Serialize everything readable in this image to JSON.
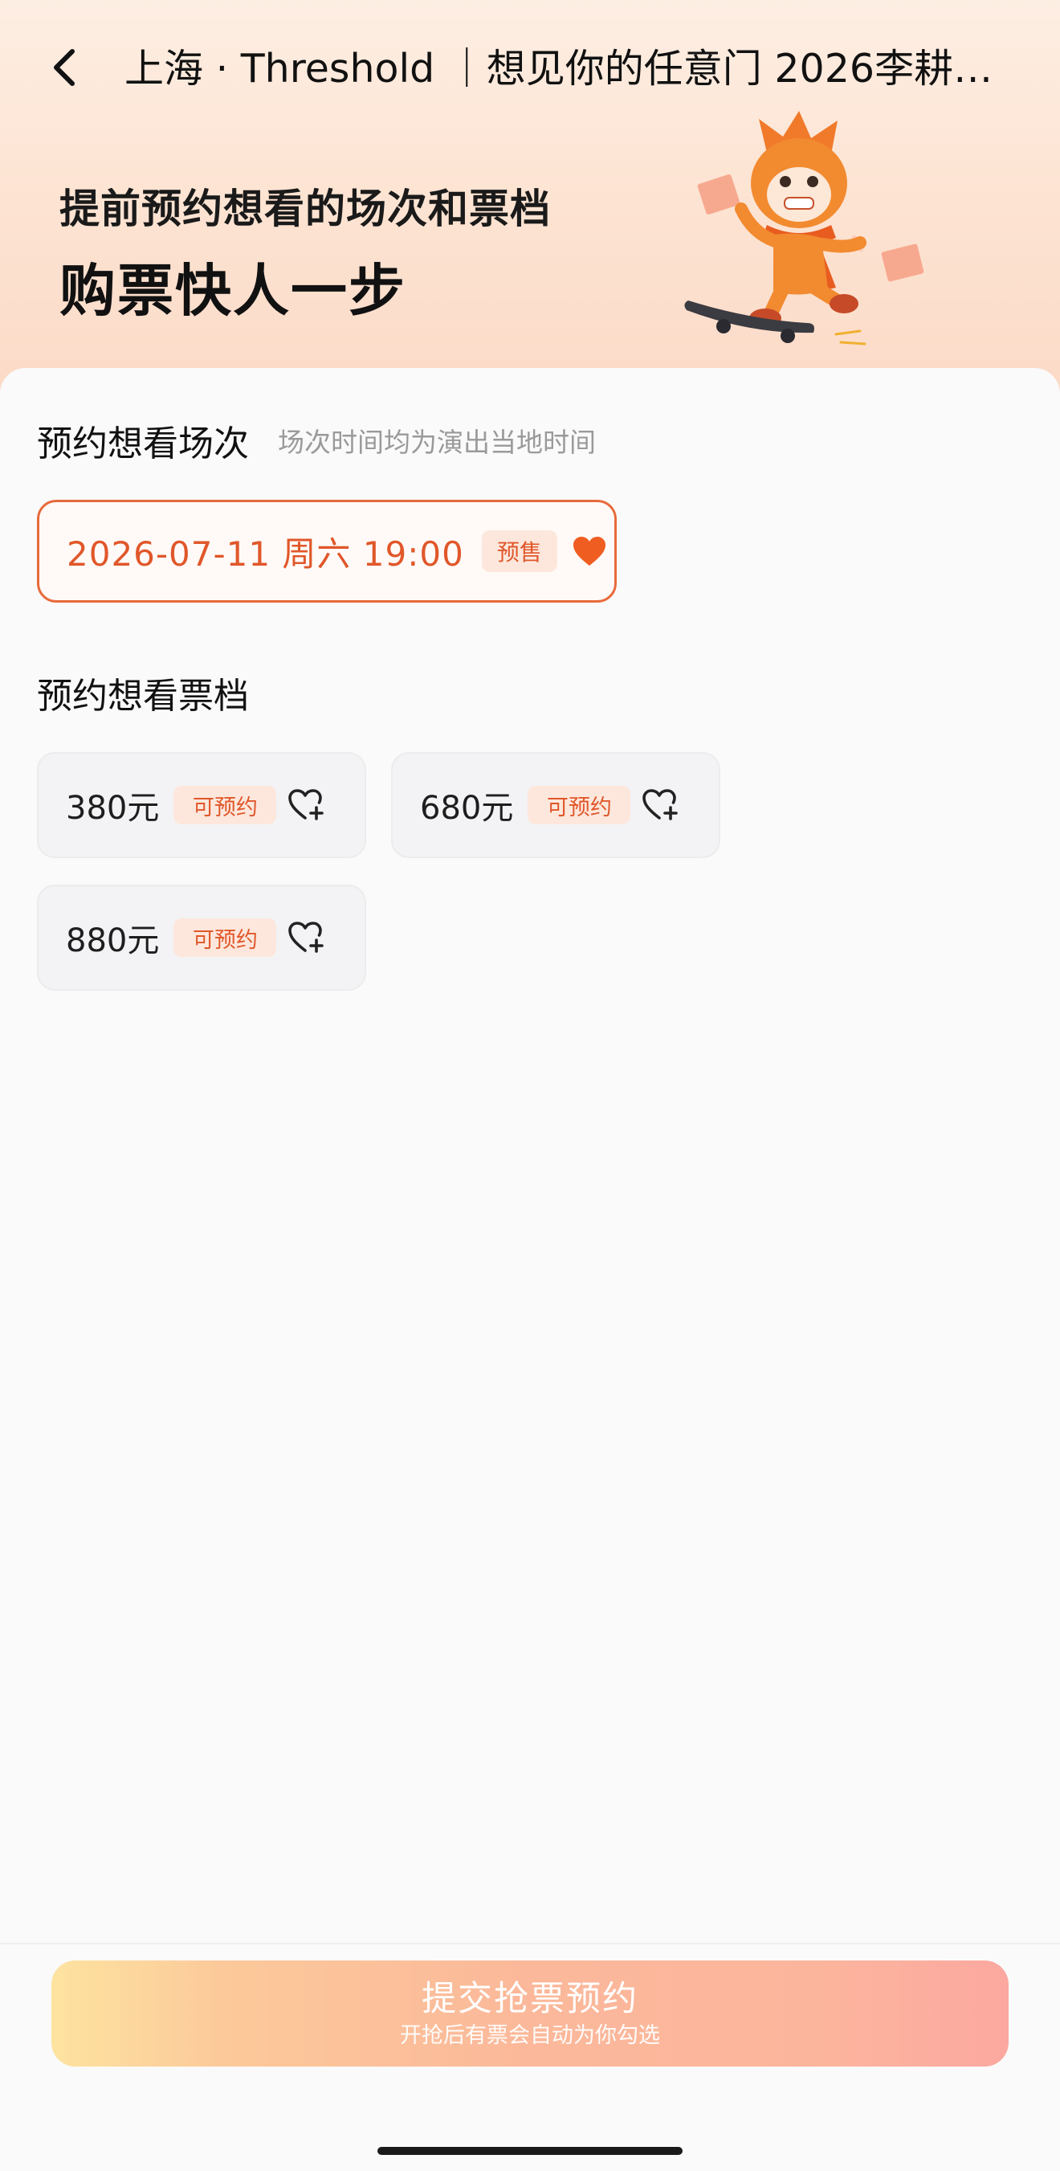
{
  "nav": {
    "title": "上海 · Threshold ｜想见你的任意门 2026李耕…"
  },
  "promo": {
    "line1": "提前预约想看的场次和票档",
    "line2": "购票快人一步"
  },
  "session_section": {
    "heading": "预约想看场次",
    "note": "场次时间均为演出当地时间",
    "sessions": [
      {
        "label": "2026-07-11 周六 19:00",
        "badge": "预售",
        "selected": true
      }
    ]
  },
  "tier_section": {
    "heading": "预约想看票档",
    "tiers": [
      {
        "label": "380元",
        "badge": "可预约"
      },
      {
        "label": "680元",
        "badge": "可预约"
      },
      {
        "label": "880元",
        "badge": "可预约"
      }
    ]
  },
  "submit": {
    "label": "提交抢票预约",
    "sublabel": "开抢后有票会自动为你勾选"
  },
  "icons": {
    "back": "chevron-left-icon",
    "selected": "heart-filled-icon",
    "add": "heart-plus-icon"
  },
  "colors": {
    "accent": "#e0572a",
    "badge_bg": "#fde7dc",
    "header_bg": "#fde4d3",
    "chip_bg": "#f3f3f5"
  }
}
